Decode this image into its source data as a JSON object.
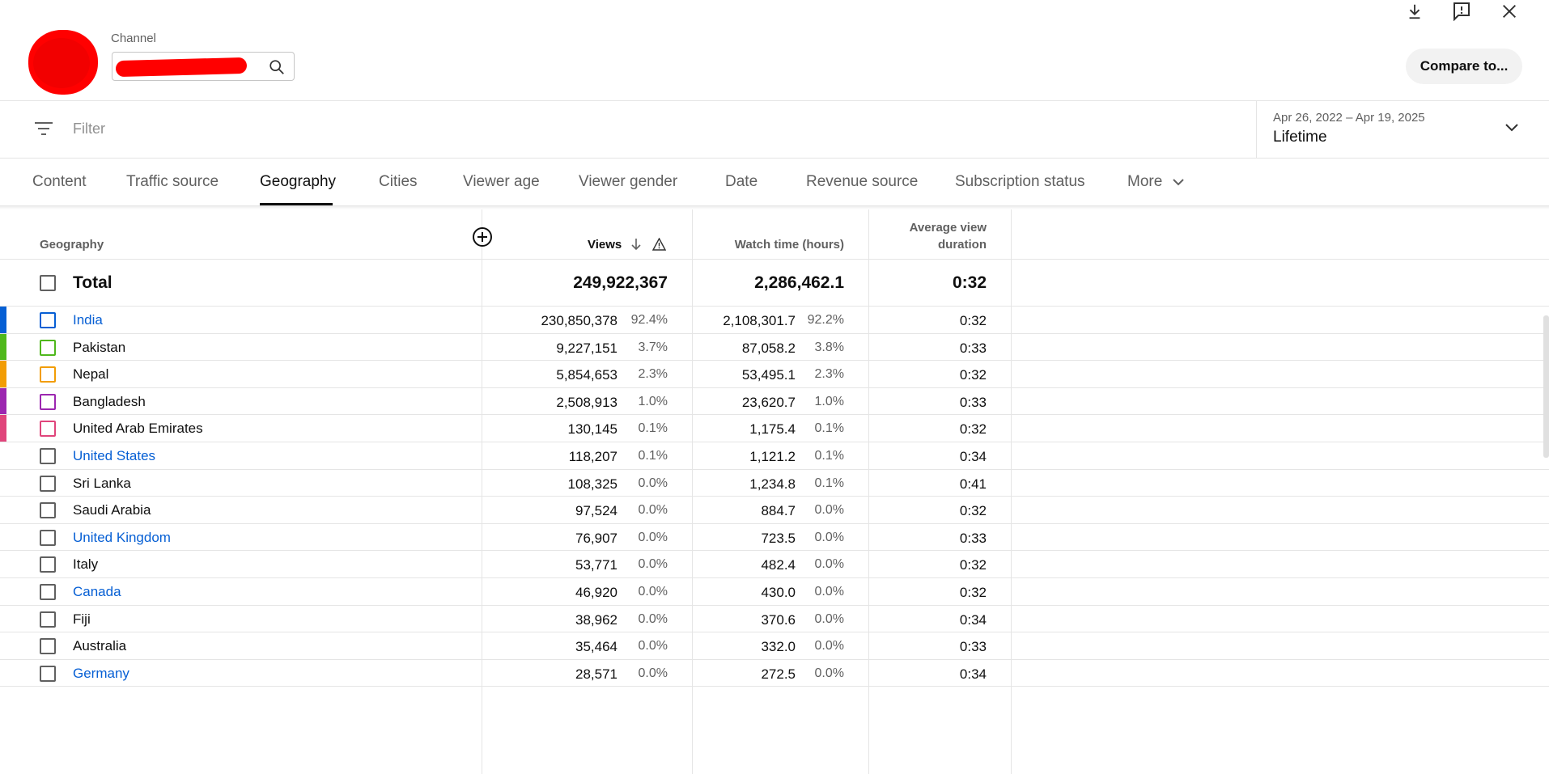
{
  "header": {
    "channel_label": "Channel",
    "compare_label": "Compare to...",
    "icons": [
      "download-icon",
      "feedback-icon",
      "close-icon",
      "search-icon"
    ]
  },
  "filter": {
    "placeholder": "Filter",
    "date_range": "Apr 26, 2022 – Apr 19, 2025",
    "date_label": "Lifetime"
  },
  "tabs": [
    {
      "label": "Content"
    },
    {
      "label": "Traffic source"
    },
    {
      "label": "Geography"
    },
    {
      "label": "Cities"
    },
    {
      "label": "Viewer age"
    },
    {
      "label": "Viewer gender"
    },
    {
      "label": "Date"
    },
    {
      "label": "Revenue source"
    },
    {
      "label": "Subscription status"
    },
    {
      "label": "More"
    }
  ],
  "table": {
    "headers": {
      "geography": "Geography",
      "views": "Views",
      "watch_time": "Watch time (hours)",
      "avg_duration_line1": "Average view",
      "avg_duration_line2": "duration"
    },
    "total": {
      "name": "Total",
      "views": "249,922,367",
      "watch_time": "2,286,462.1",
      "avg_duration": "0:32"
    },
    "rows": [
      {
        "name": "India",
        "link": true,
        "color": "#065fd4",
        "views": "230,850,378",
        "views_pct": "92.4%",
        "watch": "2,108,301.7",
        "watch_pct": "92.2%",
        "dur": "0:32"
      },
      {
        "name": "Pakistan",
        "link": false,
        "color": "#4fb81c",
        "views": "9,227,151",
        "views_pct": "3.7%",
        "watch": "87,058.2",
        "watch_pct": "3.8%",
        "dur": "0:33"
      },
      {
        "name": "Nepal",
        "link": false,
        "color": "#f29d05",
        "views": "5,854,653",
        "views_pct": "2.3%",
        "watch": "53,495.1",
        "watch_pct": "2.3%",
        "dur": "0:32"
      },
      {
        "name": "Bangladesh",
        "link": false,
        "color": "#9c27b0",
        "views": "2,508,913",
        "views_pct": "1.0%",
        "watch": "23,620.7",
        "watch_pct": "1.0%",
        "dur": "0:33"
      },
      {
        "name": "United Arab Emirates",
        "link": false,
        "color": "#e0457b",
        "views": "130,145",
        "views_pct": "0.1%",
        "watch": "1,175.4",
        "watch_pct": "0.1%",
        "dur": "0:32"
      },
      {
        "name": "United States",
        "link": true,
        "color": "",
        "views": "118,207",
        "views_pct": "0.1%",
        "watch": "1,121.2",
        "watch_pct": "0.1%",
        "dur": "0:34"
      },
      {
        "name": "Sri Lanka",
        "link": false,
        "color": "",
        "views": "108,325",
        "views_pct": "0.0%",
        "watch": "1,234.8",
        "watch_pct": "0.1%",
        "dur": "0:41"
      },
      {
        "name": "Saudi Arabia",
        "link": false,
        "color": "",
        "views": "97,524",
        "views_pct": "0.0%",
        "watch": "884.7",
        "watch_pct": "0.0%",
        "dur": "0:32"
      },
      {
        "name": "United Kingdom",
        "link": true,
        "color": "",
        "views": "76,907",
        "views_pct": "0.0%",
        "watch": "723.5",
        "watch_pct": "0.0%",
        "dur": "0:33"
      },
      {
        "name": "Italy",
        "link": false,
        "color": "",
        "views": "53,771",
        "views_pct": "0.0%",
        "watch": "482.4",
        "watch_pct": "0.0%",
        "dur": "0:32"
      },
      {
        "name": "Canada",
        "link": true,
        "color": "",
        "views": "46,920",
        "views_pct": "0.0%",
        "watch": "430.0",
        "watch_pct": "0.0%",
        "dur": "0:32"
      },
      {
        "name": "Fiji",
        "link": false,
        "color": "",
        "views": "38,962",
        "views_pct": "0.0%",
        "watch": "370.6",
        "watch_pct": "0.0%",
        "dur": "0:34"
      },
      {
        "name": "Australia",
        "link": false,
        "color": "",
        "views": "35,464",
        "views_pct": "0.0%",
        "watch": "332.0",
        "watch_pct": "0.0%",
        "dur": "0:33"
      },
      {
        "name": "Germany",
        "link": true,
        "color": "",
        "views": "28,571",
        "views_pct": "0.0%",
        "watch": "272.5",
        "watch_pct": "0.0%",
        "dur": "0:34"
      }
    ]
  }
}
